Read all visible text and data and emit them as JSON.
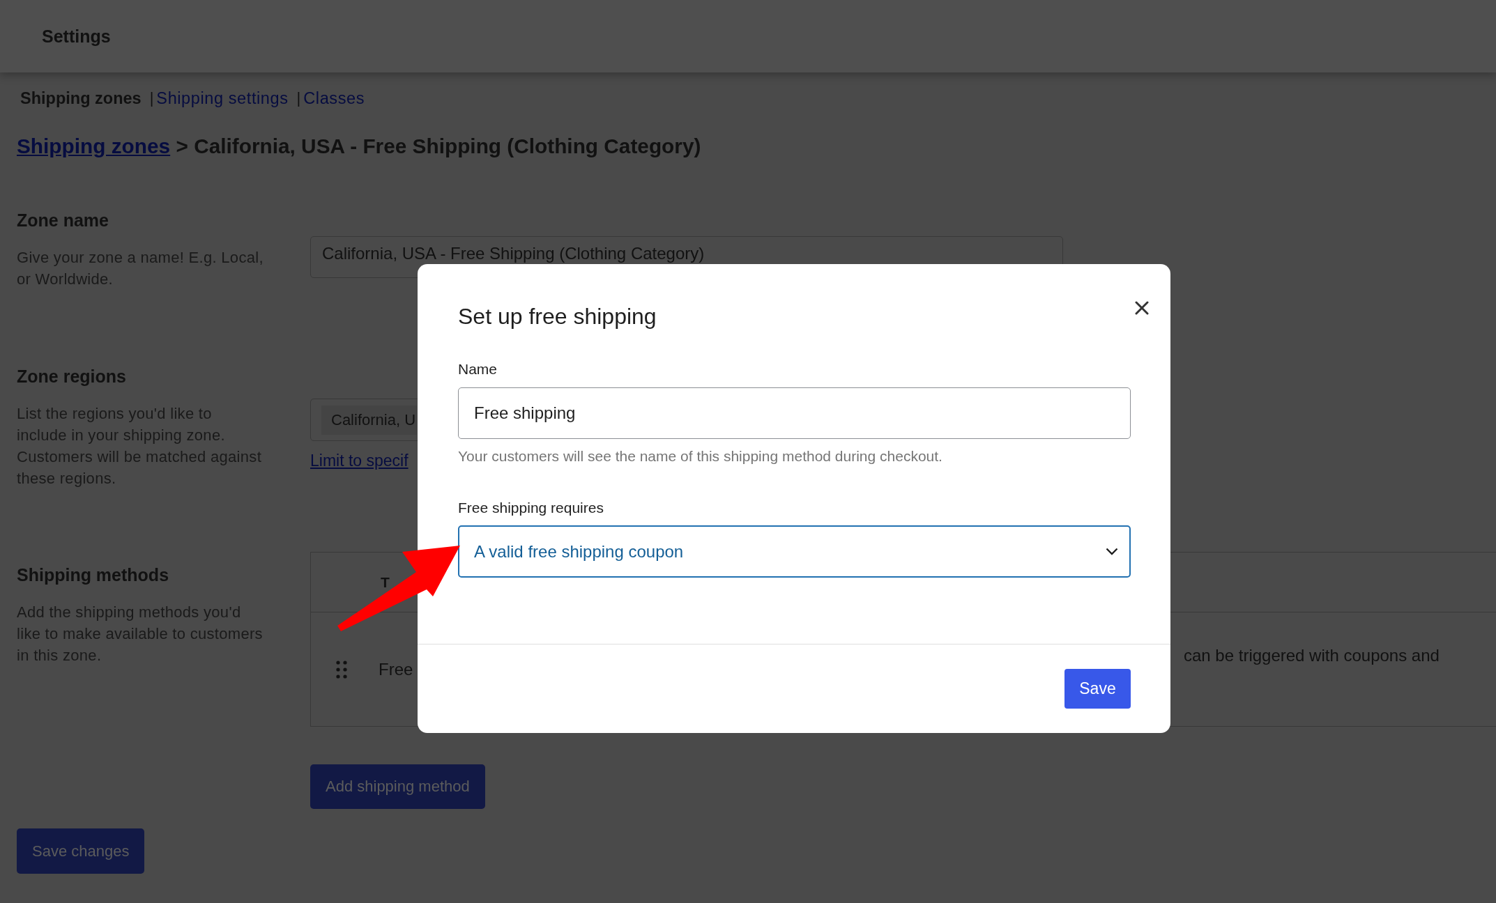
{
  "header": {
    "title": "Settings"
  },
  "tabs": [
    {
      "label": "Shipping zones",
      "selected": true
    },
    {
      "label": "Shipping settings",
      "selected": false,
      "separator": "|"
    },
    {
      "label": "Classes",
      "selected": false,
      "separator": "|"
    }
  ],
  "page_title": {
    "link": "Shipping zones",
    "text": "> California, USA - Free Shipping (Clothing Category)"
  },
  "sections": [
    {
      "kind": "text_field",
      "heading": "Zone name",
      "description": "Give your zone a name! E.g. Local, or Worldwide.",
      "value": "California, USA - Free Shipping (Clothing Category)"
    },
    {
      "kind": "region_picker",
      "heading": "Zone regions",
      "description": "List the regions you'd like to include in your shipping zone. Customers will be matched against these regions.",
      "chips": [
        "California, U"
      ],
      "link": "Limit to specif"
    },
    {
      "kind": "methods_table",
      "heading": "Shipping methods",
      "description": "Add the shipping methods you'd like to make available to customers in this zone.",
      "columns": [
        "T"
      ],
      "rows": [
        {
          "title": "Free",
          "description": "can be triggered with coupons and"
        }
      ],
      "button": "Add shipping method"
    }
  ],
  "save_button": "Save changes",
  "modal": {
    "title": "Set up free shipping",
    "fields": [
      {
        "kind": "text",
        "label": "Name",
        "value": "Free shipping",
        "help": "Your customers will see the name of this shipping method during checkout."
      },
      {
        "kind": "select",
        "label": "Free shipping requires",
        "value": "A valid free shipping coupon",
        "focused": true
      }
    ],
    "button": "Save"
  }
}
